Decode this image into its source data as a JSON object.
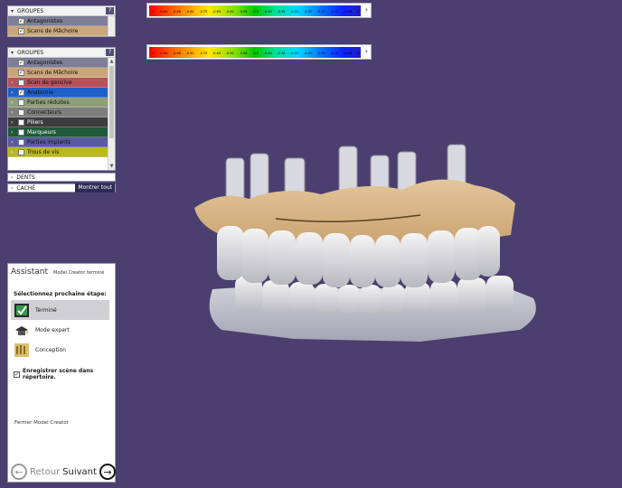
{
  "top_groups": {
    "header": "GROUPES",
    "help": "?",
    "rows": [
      {
        "label": "Antagonistes",
        "checked": true,
        "color": "#7e7e96"
      },
      {
        "label": "Scans de Mâchoire",
        "checked": true,
        "color": "#c9a77a"
      }
    ]
  },
  "groups": {
    "header": "GROUPES",
    "help": "?",
    "rows": [
      {
        "label": "Antagonistes",
        "checked": true,
        "expand": false,
        "color": "#7e7e96",
        "dark": false
      },
      {
        "label": "Scans de Mâchoire",
        "checked": true,
        "expand": false,
        "color": "#c9a77a",
        "dark": false
      },
      {
        "label": "Scan de gencive",
        "checked": false,
        "expand": true,
        "color": "#b8505a",
        "dark": false
      },
      {
        "label": "Anatomie",
        "checked": true,
        "expand": true,
        "color": "#1f5fc8",
        "dark": false
      },
      {
        "label": "Parties réduites",
        "checked": false,
        "expand": true,
        "color": "#8e9e7a",
        "dark": false
      },
      {
        "label": "Connecteurs",
        "checked": false,
        "expand": true,
        "color": "#7e7e7e",
        "dark": false
      },
      {
        "label": "Piliers",
        "checked": false,
        "expand": true,
        "color": "#3c3c3c",
        "dark": true
      },
      {
        "label": "Marqueurs",
        "checked": false,
        "expand": true,
        "color": "#1f5a3a",
        "dark": true
      },
      {
        "label": "Parties implants",
        "checked": false,
        "expand": true,
        "color": "#5a5aa0",
        "dark": false
      },
      {
        "label": "Trous de vis",
        "checked": false,
        "expand": true,
        "color": "#b8b820",
        "dark": false
      }
    ]
  },
  "dents_label": "DENTS",
  "cache_label": "CACHÉ",
  "show_all_label": "Montrer tout",
  "scales": [
    {
      "ticks": [
        "-1",
        "-0.94",
        "-0.88",
        "-0.81",
        "-0.75",
        "-0.69",
        "-0.62",
        "-0.56",
        "-0.5",
        "-0.44",
        "-0.38",
        "-0.31",
        "-0.25",
        "-0.19",
        "-0.12",
        "-0.06",
        "0"
      ]
    },
    {
      "ticks": [
        "-1",
        "-0.94",
        "-0.88",
        "-0.81",
        "-0.75",
        "-0.69",
        "-0.62",
        "-0.56",
        "-0.5",
        "-0.44",
        "-0.38",
        "-0.31",
        "-0.25",
        "-0.19",
        "-0.12",
        "-0.06",
        "0"
      ]
    }
  ],
  "assistant": {
    "title": "Assistant",
    "status": "Model Creator terminé",
    "prompt": "Sélectionnez prochaine étape:",
    "options": [
      {
        "label": "Terminé",
        "icon": "finish-check-icon",
        "selected": true
      },
      {
        "label": "Mode expert",
        "icon": "expert-mode-icon",
        "selected": false
      },
      {
        "label": "Conception",
        "icon": "design-icon",
        "selected": false
      }
    ],
    "save_label": "Enregistrer scène dans répertoire.",
    "close_label": "Fermer Model Creator",
    "back_label": "Retour",
    "next_label": "Suivant"
  }
}
